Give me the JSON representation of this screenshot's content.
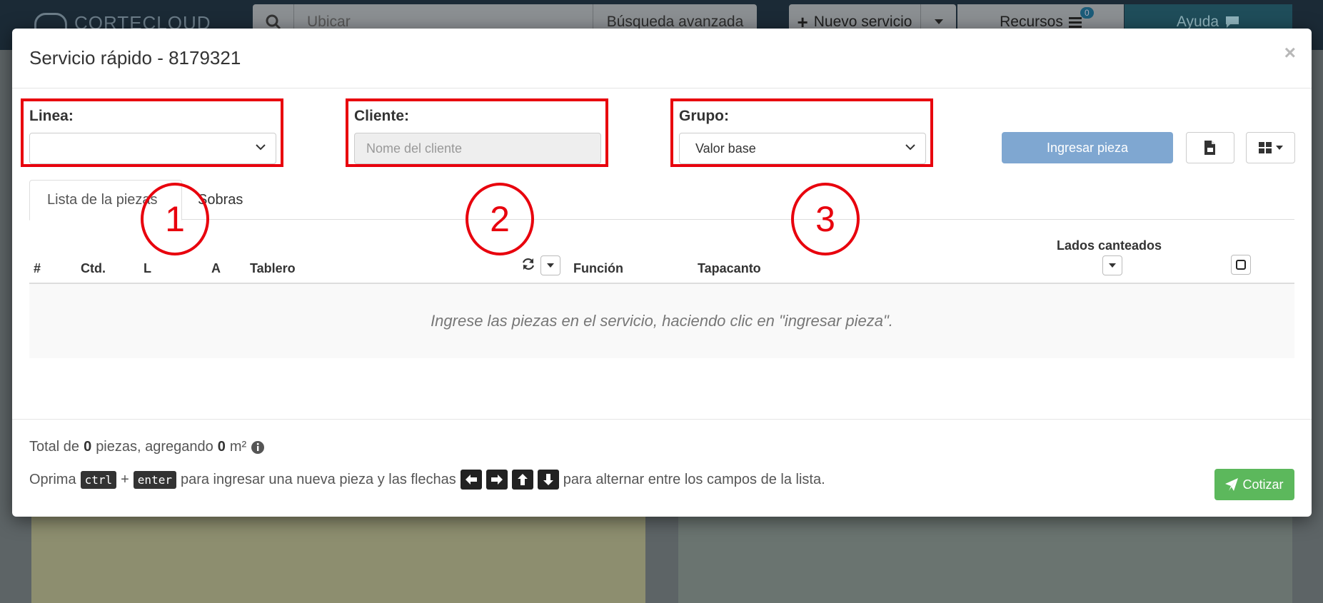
{
  "app": {
    "logo_text": "CORTECLOUD",
    "search_placeholder": "Ubicar",
    "advanced_search_label": "Búsqueda avanzada",
    "new_service_label": "Nuevo servicio",
    "resources_label": "Recursos",
    "resources_badge": "0",
    "help_label": "Ayuda"
  },
  "modal": {
    "title": "Servicio rápido - 8179321",
    "close_label": "×"
  },
  "form": {
    "linea_label": "Linea:",
    "linea_value": "",
    "cliente_label": "Cliente:",
    "cliente_placeholder": "Nome del cliente",
    "grupo_label": "Grupo:",
    "grupo_value": "Valor base",
    "ingresar_label": "Ingresar pieza"
  },
  "tabs": [
    {
      "label": "Lista de la piezas",
      "active": true
    },
    {
      "label": "Sobras",
      "active": false
    }
  ],
  "table": {
    "headers": {
      "num": "#",
      "ctd": "Ctd.",
      "l": "L",
      "a": "A",
      "tablero": "Tablero",
      "funcion": "Función",
      "tapacanto": "Tapacanto",
      "lados": "Lados canteados"
    },
    "empty_message": "Ingrese las piezas en el servicio, haciendo clic en \"ingresar pieza\"."
  },
  "footer": {
    "total_prefix": "Total de",
    "total_count": "0",
    "total_mid": "piezas, agregando",
    "total_area": "0",
    "total_unit": "m²",
    "hint_prefix": "Oprima",
    "key_ctrl": "ctrl",
    "plus": "+",
    "key_enter": "enter",
    "hint_mid": "para ingresar una nueva pieza y las flechas",
    "hint_suffix": "para alternar entre los campos de la lista.",
    "cotizar_label": "Cotizar"
  },
  "annotations": [
    "1",
    "2",
    "3"
  ],
  "colors": {
    "annotation_red": "#e8000d",
    "primary_button": "#7fa7d1",
    "success_button": "#5cb85c"
  }
}
